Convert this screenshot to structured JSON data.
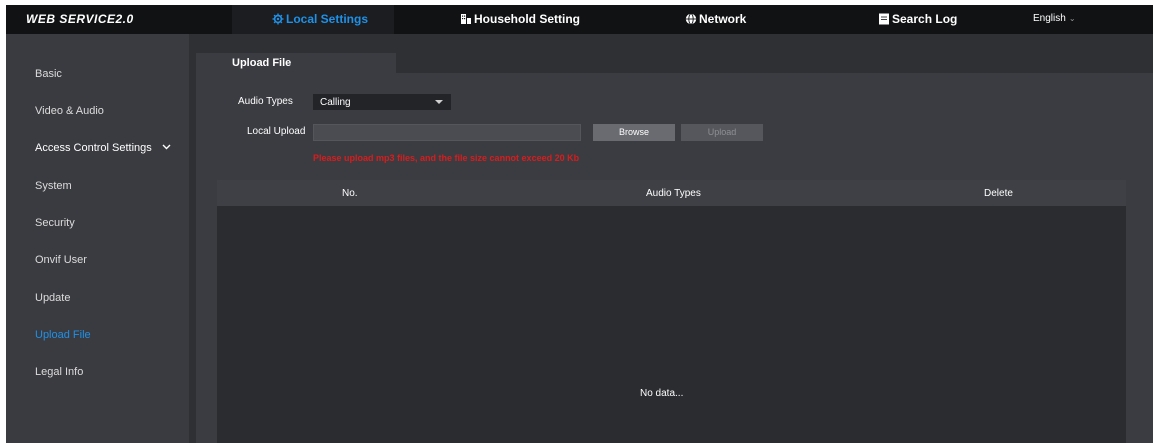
{
  "app": {
    "logo": "WEB SERVICE2.0"
  },
  "nav": [
    {
      "label": "Local Settings",
      "icon": "gear-icon",
      "active": true
    },
    {
      "label": "Household Setting",
      "icon": "building-icon",
      "active": false
    },
    {
      "label": "Network",
      "icon": "globe-icon",
      "active": false
    },
    {
      "label": "Search Log",
      "icon": "document-icon",
      "active": false
    }
  ],
  "language": {
    "label": "English"
  },
  "sidebar": {
    "items": [
      {
        "label": "Basic"
      },
      {
        "label": "Video & Audio"
      },
      {
        "label": "Access Control Settings"
      },
      {
        "label": "System"
      },
      {
        "label": "Security"
      },
      {
        "label": "Onvif User"
      },
      {
        "label": "Update"
      },
      {
        "label": "Upload File",
        "active": true
      },
      {
        "label": "Legal Info"
      }
    ]
  },
  "main": {
    "tab": "Upload File",
    "audio_types_label": "Audio Types",
    "audio_types_value": "Calling",
    "local_upload_label": "Local Upload",
    "local_upload_value": "",
    "browse_label": "Browse",
    "upload_label": "Upload",
    "hint": "Please upload mp3 files, and the file size cannot exceed 20 Kb",
    "table": {
      "columns": [
        "No.",
        "Audio Types",
        "Delete"
      ],
      "rows": [],
      "empty_text": "No data..."
    }
  },
  "colors": {
    "accent": "#1e91e8",
    "warning": "#d81d1d",
    "panel": "#3b3c41",
    "topbar": "#111214"
  }
}
